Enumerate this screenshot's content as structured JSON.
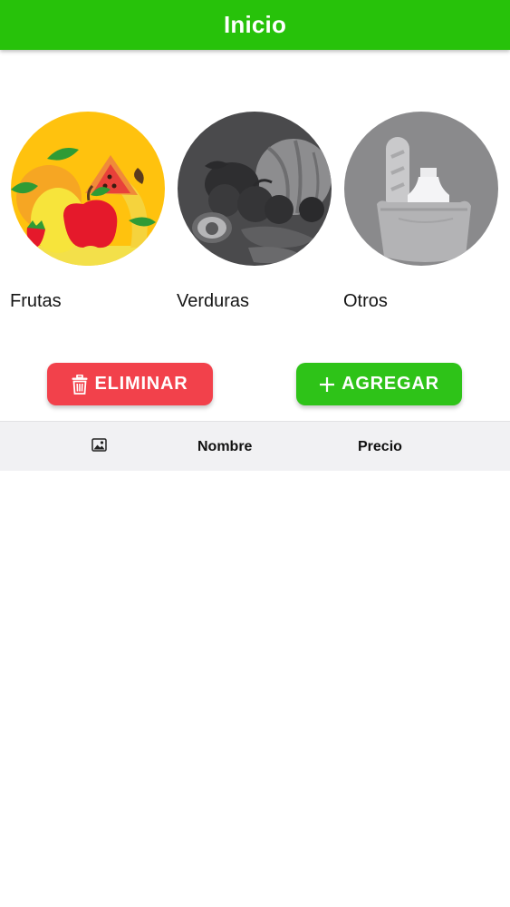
{
  "app": {
    "title": "Inicio"
  },
  "colors": {
    "primary": "#27c20a",
    "danger": "#f2414b",
    "success": "#2ec318",
    "table_header_bg": "#f1f1f3"
  },
  "categories": [
    {
      "label": "Frutas",
      "image": "fruits-illustration"
    },
    {
      "label": "Verduras",
      "image": "vegetables-illustration"
    },
    {
      "label": "Otros",
      "image": "groceries-bag-illustration"
    }
  ],
  "actions": {
    "delete": {
      "label": "ELIMINAR",
      "icon": "trash-icon"
    },
    "add": {
      "label": "AGREGAR",
      "icon": "plus-icon"
    }
  },
  "table": {
    "columns": [
      {
        "label": "",
        "icon": "image-icon"
      },
      {
        "label": "Nombre"
      },
      {
        "label": "Precio"
      }
    ],
    "rows": []
  }
}
